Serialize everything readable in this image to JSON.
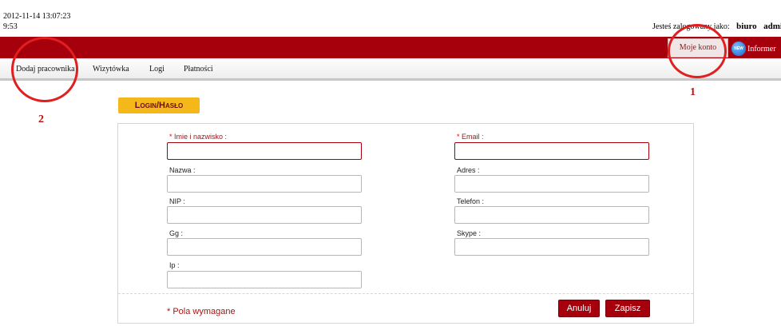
{
  "timestamp": {
    "line1": "2012-11-14 13:07:23",
    "line2": "9:53"
  },
  "header": {
    "logged_as_label": "Jesteś zalogowany jako:",
    "user_part1": "biuro",
    "user_part2": "admi"
  },
  "top_menu": {
    "my_account": "Moje konto",
    "new_badge": "NEW",
    "informer": "Informer"
  },
  "nav": {
    "items": [
      {
        "label": "Dodaj pracownika"
      },
      {
        "label": "Wizytówka"
      },
      {
        "label": "Logi"
      },
      {
        "label": "Płatności"
      }
    ]
  },
  "annotations": {
    "one": "1",
    "two": "2"
  },
  "form": {
    "section_title": "Login/Hasło",
    "fields": {
      "name": {
        "label": "Imie i nazwisko :",
        "value": ""
      },
      "email": {
        "label": "Email :",
        "value": ""
      },
      "nazwa": {
        "label": "Nazwa :",
        "value": ""
      },
      "adres": {
        "label": "Adres :",
        "value": ""
      },
      "nip": {
        "label": "NIP :",
        "value": ""
      },
      "telefon": {
        "label": "Telefon :",
        "value": ""
      },
      "gg": {
        "label": "Gg :",
        "value": ""
      },
      "skype": {
        "label": "Skype :",
        "value": ""
      },
      "ip": {
        "label": "Ip :",
        "value": ""
      }
    },
    "required_asterisk": "*",
    "required_note": "Pola wymagane",
    "cancel_label": "Anuluj",
    "save_label": "Zapisz"
  },
  "colors": {
    "brand_red": "#a5000c",
    "tab_yellow": "#f5b81a",
    "annotation_red": "#e02020"
  }
}
